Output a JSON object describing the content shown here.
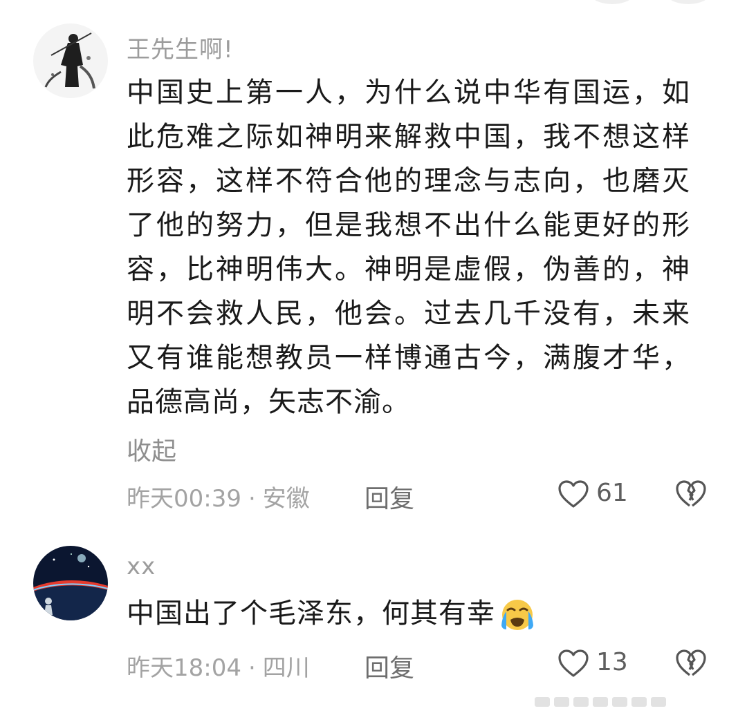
{
  "comments": [
    {
      "username": "王先生啊!",
      "text": "中国史上第一人，为什么说中华有国运，如此危难之际如神明来解救中国，我不想这样形容，这样不符合他的理念与志向，也磨灭了他的努力，但是我想不出什么能更好的形容，比神明伟大。神明是虚假，伪善的，神明不会救人民，他会。过去几千没有，未来又有谁能想教员一样博通古今，满腹才华，品德高尚，矢志不渝。",
      "collapse_label": "收起",
      "time": "昨天00:39",
      "separator": "·",
      "location": "安徽",
      "reply_label": "回复",
      "likes": "61",
      "icons": [
        "warrior-avatar",
        "heart-outline-icon",
        "broken-heart-icon"
      ]
    },
    {
      "username": "xx",
      "text": "中国出了个毛泽东，何其有幸",
      "emoji": "loudly-crying-face-icon",
      "time": "昨天18:04",
      "separator": "·",
      "location": "四川",
      "reply_label": "回复",
      "likes": "13",
      "icons": [
        "earth-space-avatar",
        "heart-outline-icon",
        "broken-heart-icon"
      ]
    }
  ],
  "colors": {
    "username": "#9c9c9c",
    "body_text": "#1a1a1a",
    "meta_text": "#a3a3a3",
    "emoji_face": "#f7c948",
    "emoji_tears": "#3fa9f5"
  }
}
